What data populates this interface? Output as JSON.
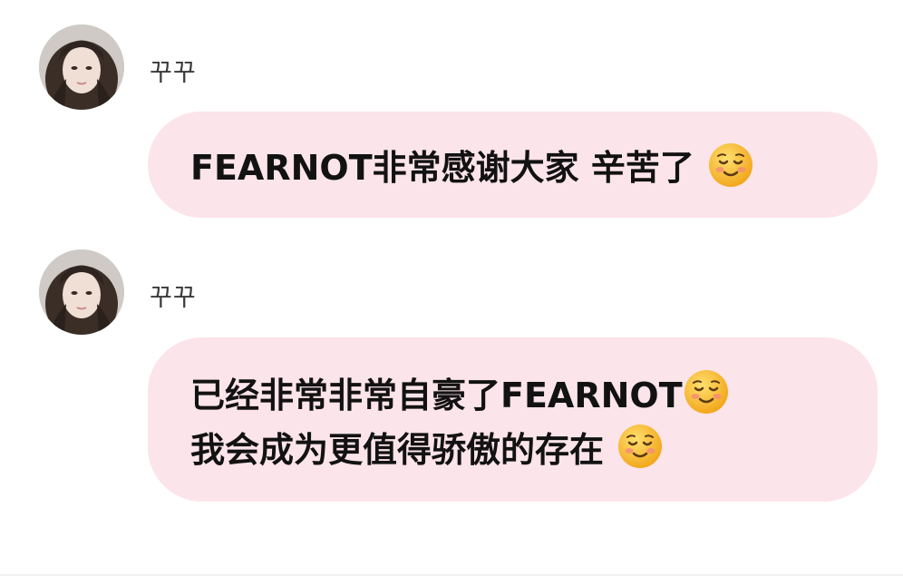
{
  "messages": [
    {
      "sender": "꾸꾸",
      "lines": [
        {
          "text": "FEARNOT非常感谢大家 辛苦了",
          "emoji": "smiling-face-icon"
        }
      ]
    },
    {
      "sender": "꾸꾸",
      "lines": [
        {
          "text": "已经非常非常自豪了FEARNOT",
          "emoji": "smiling-face-icon"
        },
        {
          "text": "我会成为更值得骄傲的存在",
          "emoji": "smiling-face-icon"
        }
      ]
    }
  ],
  "colors": {
    "bubble": "#fbe4ea",
    "text": "#121212",
    "sender": "#3a3a3a"
  }
}
